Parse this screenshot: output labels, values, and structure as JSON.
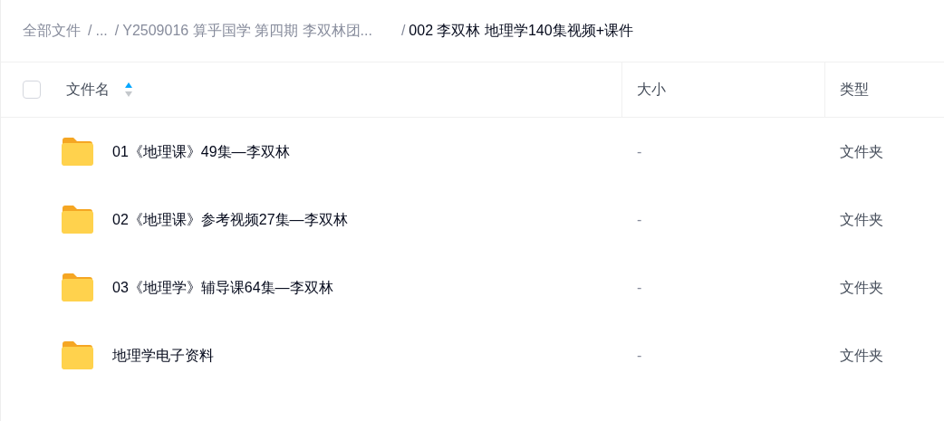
{
  "breadcrumb": [
    {
      "label": "全部文件",
      "current": false
    },
    {
      "separator": "/",
      "label": "...",
      "current": false
    },
    {
      "separator": "/",
      "label": "Y2509016 算乎国学 第四期 李双林团...",
      "current": false
    },
    {
      "separator": "/",
      "label": "002 李双林 地理学140集视频+课件",
      "current": true
    }
  ],
  "table": {
    "select_all": {
      "checked": false
    },
    "columns": [
      {
        "label": "文件名",
        "sorted": true,
        "ascending": true
      },
      {
        "label": "大小"
      },
      {
        "label": "类型"
      }
    ],
    "rows": [
      {
        "name": "01《地理课》49集—李双林",
        "size": "-",
        "type": "文件夹"
      },
      {
        "name": "02《地理课》参考视频27集—李双林",
        "size": "-",
        "type": "文件夹"
      },
      {
        "name": "03《地理学》辅导课64集—李双林",
        "size": "-",
        "type": "文件夹"
      },
      {
        "name": "地理学电子资料",
        "size": "-",
        "type": "文件夹"
      }
    ]
  }
}
